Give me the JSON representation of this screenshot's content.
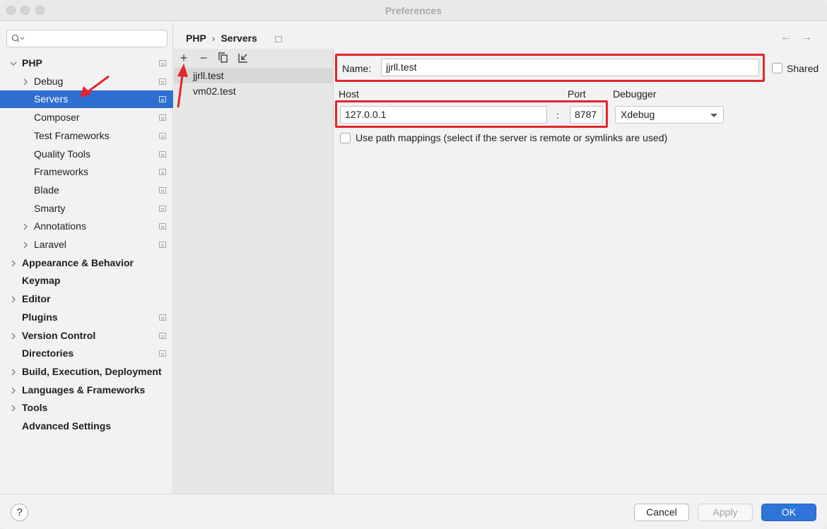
{
  "window": {
    "title": "Preferences"
  },
  "search": {
    "placeholder": "",
    "icon": "search-icon"
  },
  "sidebar": {
    "items": [
      {
        "label": "PHP",
        "bold": true,
        "expanded": true,
        "indent": 0,
        "has_children": true,
        "page_icon": true
      },
      {
        "label": "Debug",
        "bold": false,
        "indent": 1,
        "has_children": true,
        "page_icon": true
      },
      {
        "label": "Servers",
        "bold": false,
        "indent": 1,
        "has_children": false,
        "page_icon": true,
        "selected": true
      },
      {
        "label": "Composer",
        "bold": false,
        "indent": 1,
        "has_children": false,
        "page_icon": true
      },
      {
        "label": "Test Frameworks",
        "bold": false,
        "indent": 1,
        "has_children": false,
        "page_icon": true
      },
      {
        "label": "Quality Tools",
        "bold": false,
        "indent": 1,
        "has_children": false,
        "page_icon": true
      },
      {
        "label": "Frameworks",
        "bold": false,
        "indent": 1,
        "has_children": false,
        "page_icon": true
      },
      {
        "label": "Blade",
        "bold": false,
        "indent": 1,
        "has_children": false,
        "page_icon": true
      },
      {
        "label": "Smarty",
        "bold": false,
        "indent": 1,
        "has_children": false,
        "page_icon": true
      },
      {
        "label": "Annotations",
        "bold": false,
        "indent": 1,
        "has_children": true,
        "page_icon": true
      },
      {
        "label": "Laravel",
        "bold": false,
        "indent": 1,
        "has_children": true,
        "page_icon": true
      },
      {
        "label": "Appearance & Behavior",
        "bold": true,
        "indent": 0,
        "has_children": true,
        "page_icon": false
      },
      {
        "label": "Keymap",
        "bold": true,
        "indent": 0,
        "has_children": false,
        "page_icon": false
      },
      {
        "label": "Editor",
        "bold": true,
        "indent": 0,
        "has_children": true,
        "page_icon": false
      },
      {
        "label": "Plugins",
        "bold": true,
        "indent": 0,
        "has_children": false,
        "page_icon": true
      },
      {
        "label": "Version Control",
        "bold": true,
        "indent": 0,
        "has_children": true,
        "page_icon": true
      },
      {
        "label": "Directories",
        "bold": true,
        "indent": 0,
        "has_children": false,
        "page_icon": true
      },
      {
        "label": "Build, Execution, Deployment",
        "bold": true,
        "indent": 0,
        "has_children": true,
        "page_icon": false
      },
      {
        "label": "Languages & Frameworks",
        "bold": true,
        "indent": 0,
        "has_children": true,
        "page_icon": false
      },
      {
        "label": "Tools",
        "bold": true,
        "indent": 0,
        "has_children": true,
        "page_icon": false
      },
      {
        "label": "Advanced Settings",
        "bold": true,
        "indent": 0,
        "has_children": false,
        "page_icon": false
      }
    ]
  },
  "breadcrumb": {
    "parent": "PHP",
    "separator": "›",
    "current": "Servers"
  },
  "nav": {
    "back": "←",
    "forward": "→"
  },
  "toolbar": {
    "add": "+",
    "remove": "−",
    "copy_icon": "copy-icon",
    "import_icon": "import-icon"
  },
  "servers": [
    {
      "name": "jjrll.test",
      "active": true
    },
    {
      "name": "vm02.test",
      "active": false
    }
  ],
  "form": {
    "name_label": "Name:",
    "name_value": "jjrll.test",
    "shared_label": "Shared",
    "shared_checked": false,
    "host_label": "Host",
    "host_value": "127.0.0.1",
    "port_separator": ":",
    "port_label": "Port",
    "port_value": "8787",
    "debugger_label": "Debugger",
    "debugger_value": "Xdebug",
    "path_mappings_label": "Use path mappings (select if the server is remote or symlinks are used)",
    "path_mappings_checked": false
  },
  "footer": {
    "help": "?",
    "cancel": "Cancel",
    "apply": "Apply",
    "ok": "OK"
  },
  "colors": {
    "selection": "#2f6fd1",
    "annotation": "#e3262c",
    "ok_button": "#2f74d8"
  }
}
